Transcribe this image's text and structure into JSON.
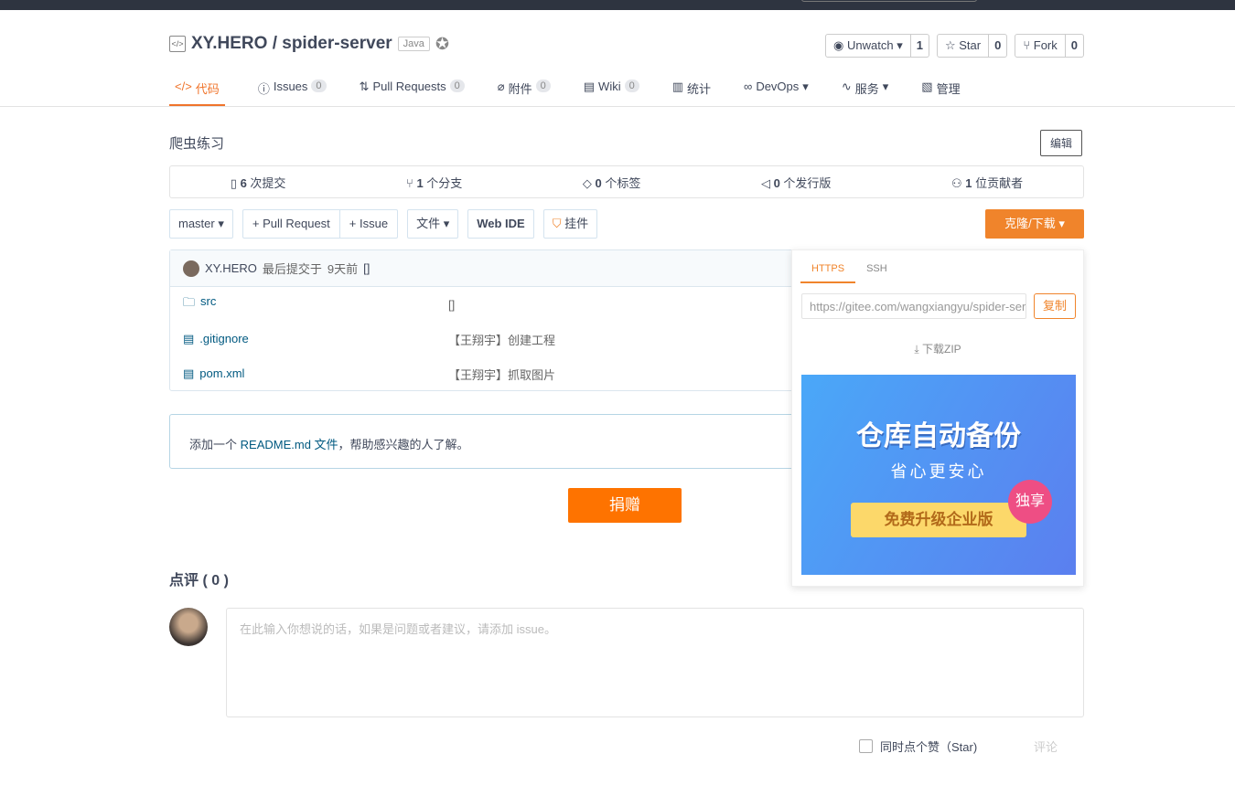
{
  "repo": {
    "owner_repo": "XY.HERO / spider-server",
    "language": "Java"
  },
  "actions": {
    "watch_label": "Unwatch",
    "watch_count": "1",
    "star_label": "Star",
    "star_count": "0",
    "fork_label": "Fork",
    "fork_count": "0"
  },
  "nav": [
    {
      "label": "代码"
    },
    {
      "label": "Issues",
      "count": "0"
    },
    {
      "label": "Pull Requests",
      "count": "0"
    },
    {
      "label": "附件",
      "count": "0"
    },
    {
      "label": "Wiki",
      "count": "0"
    },
    {
      "label": "统计"
    },
    {
      "label": "DevOps"
    },
    {
      "label": "服务"
    },
    {
      "label": "管理"
    }
  ],
  "description": "爬虫练习",
  "edit_label": "编辑",
  "stats": [
    {
      "num": "6",
      "label": "次提交"
    },
    {
      "num": "1",
      "label": "个分支"
    },
    {
      "num": "0",
      "label": "个标签"
    },
    {
      "num": "0",
      "label": "个发行版"
    },
    {
      "num": "1",
      "label": "位贡献者"
    }
  ],
  "toolbar": {
    "branch": "master",
    "pr": "+ Pull Request",
    "issue": "+ Issue",
    "files": "文件",
    "webide": "Web IDE",
    "pendant": "挂件",
    "clone": "克隆/下载"
  },
  "commit": {
    "author": "XY.HERO",
    "text": "最后提交于",
    "time": "9天前",
    "hash": "[]"
  },
  "files": [
    {
      "name": "src",
      "msg": "[]"
    },
    {
      "name": ".gitignore",
      "msg": "【王翔宇】创建工程"
    },
    {
      "name": "pom.xml",
      "msg": "【王翔宇】抓取图片"
    }
  ],
  "readme": {
    "prefix": "添加一个",
    "link": "README.md 文件",
    "suffix": "，帮助感兴趣的人了解。"
  },
  "donate": "捐赠",
  "comments": {
    "title": "点评 ( 0 )",
    "placeholder": "在此输入你想说的话，如果是问题或者建议，请添加 issue。",
    "star_label": "同时点个赞（Star)",
    "submit": "评论"
  },
  "clone_dropdown": {
    "tab_https": "HTTPS",
    "tab_ssh": "SSH",
    "url": "https://gitee.com/wangxiangyu/spider-server.git",
    "copy": "复制",
    "download_zip": "下载ZIP",
    "ad": {
      "title": "仓库自动备份",
      "subtitle": "省心更安心",
      "cta": "免费升级企业版",
      "tag": "独享"
    }
  }
}
